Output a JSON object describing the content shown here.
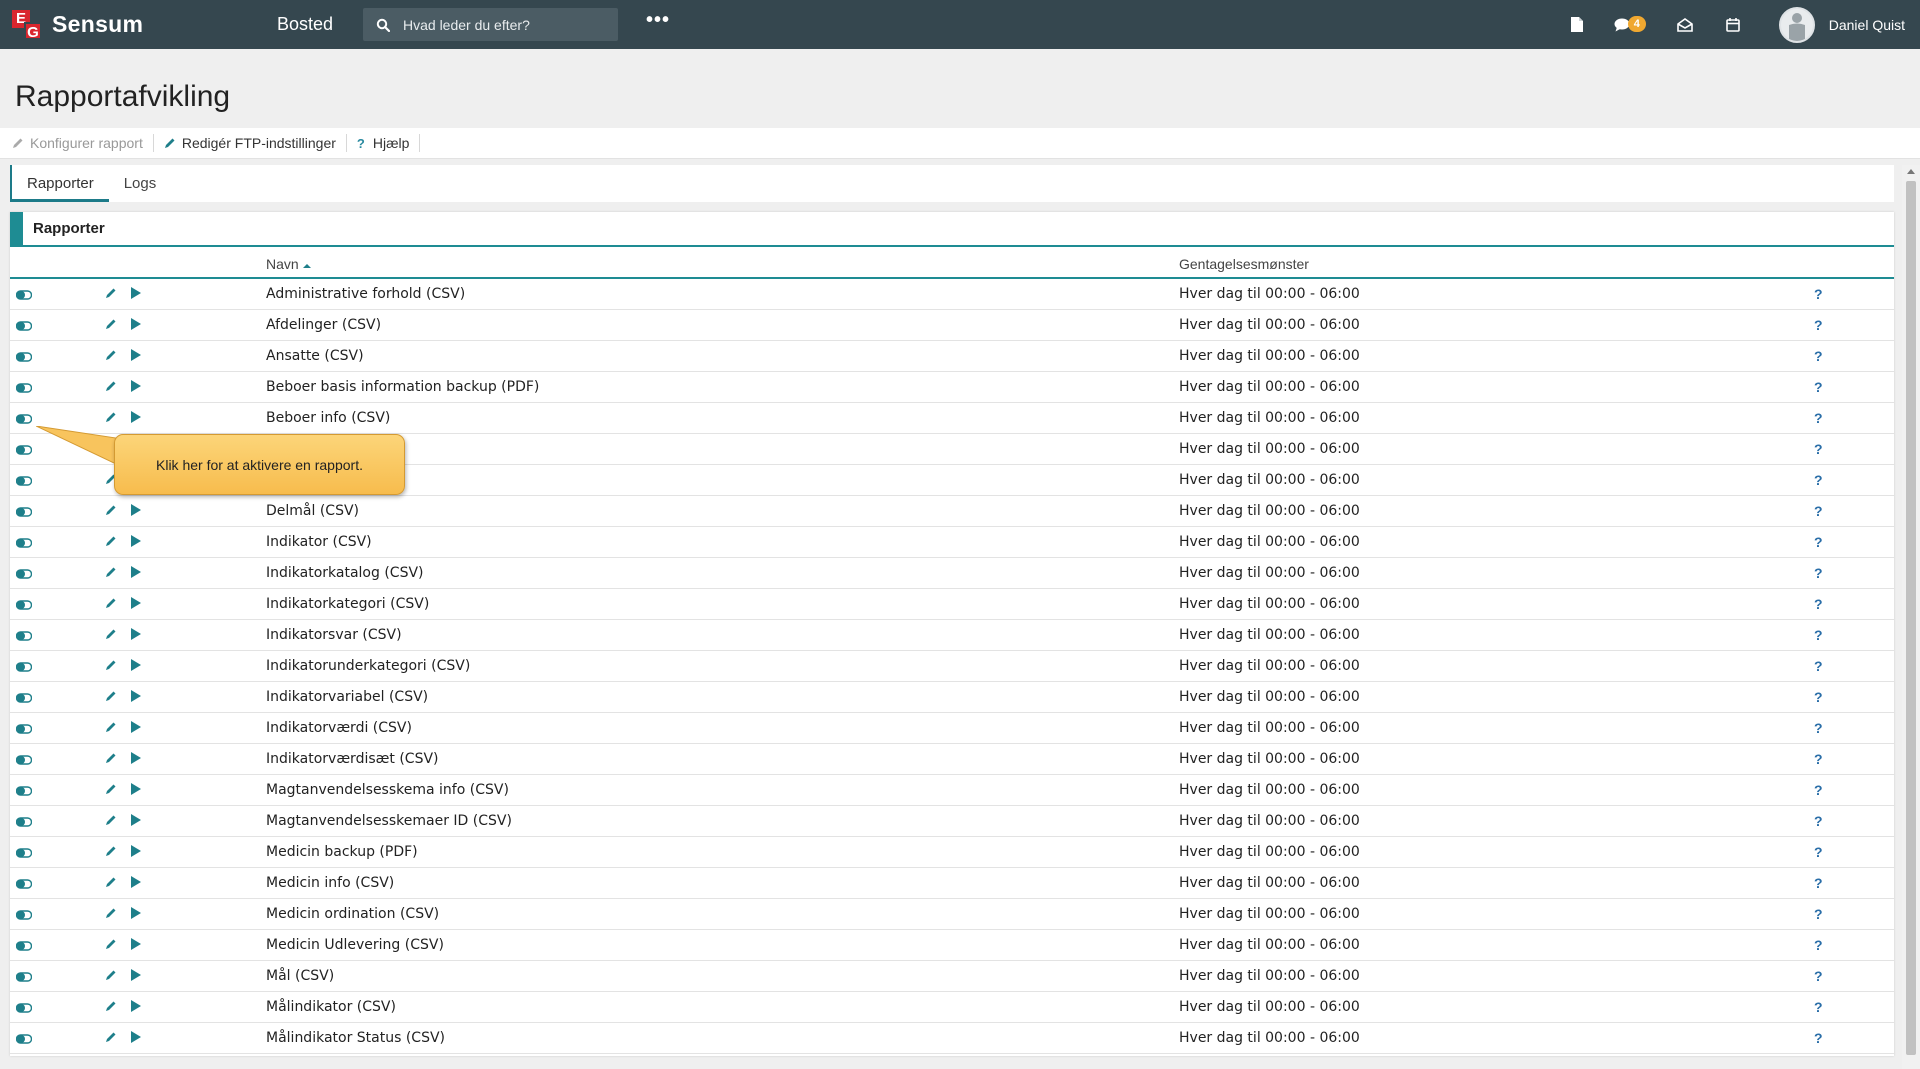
{
  "app": {
    "logo_e": "E",
    "logo_g": "G",
    "logo_text": "Sensum",
    "module": "Bosted",
    "search_placeholder": "Hvad leder du efter?",
    "more": "•••",
    "message_count": "4",
    "user_name": "Daniel Quist"
  },
  "page": {
    "title": "Rapportafvikling",
    "actions": {
      "configure": "Konfigurer rapport",
      "ftp": "Redigér FTP-indstillinger",
      "help_mark": "?",
      "help": "Hjælp"
    },
    "tabs": [
      "Rapporter",
      "Logs"
    ]
  },
  "panel": {
    "title": "Rapporter",
    "columns": {
      "name": "Navn",
      "pattern": "Gentagelsesmønster"
    },
    "rows": [
      {
        "name": "Administrative forhold (CSV)",
        "pattern": "Hver dag til 00:00 - 06:00",
        "help": "?"
      },
      {
        "name": "Afdelinger (CSV)",
        "pattern": "Hver dag til 00:00 - 06:00",
        "help": "?"
      },
      {
        "name": "Ansatte (CSV)",
        "pattern": "Hver dag til 00:00 - 06:00",
        "help": "?"
      },
      {
        "name": "Beboer basis information backup (PDF)",
        "pattern": "Hver dag til 00:00 - 06:00",
        "help": "?"
      },
      {
        "name": "Beboer info (CSV)",
        "pattern": "Hver dag til 00:00 - 06:00",
        "help": "?"
      },
      {
        "name": "",
        "pattern": "Hver dag til 00:00 - 06:00",
        "help": "?"
      },
      {
        "name": "",
        "pattern": "Hver dag til 00:00 - 06:00",
        "help": "?"
      },
      {
        "name": "Delmål (CSV)",
        "pattern": "Hver dag til 00:00 - 06:00",
        "help": "?"
      },
      {
        "name": "Indikator (CSV)",
        "pattern": "Hver dag til 00:00 - 06:00",
        "help": "?"
      },
      {
        "name": "Indikatorkatalog (CSV)",
        "pattern": "Hver dag til 00:00 - 06:00",
        "help": "?"
      },
      {
        "name": "Indikatorkategori (CSV)",
        "pattern": "Hver dag til 00:00 - 06:00",
        "help": "?"
      },
      {
        "name": "Indikatorsvar (CSV)",
        "pattern": "Hver dag til 00:00 - 06:00",
        "help": "?"
      },
      {
        "name": "Indikatorunderkategori (CSV)",
        "pattern": "Hver dag til 00:00 - 06:00",
        "help": "?"
      },
      {
        "name": "Indikatorvariabel (CSV)",
        "pattern": "Hver dag til 00:00 - 06:00",
        "help": "?"
      },
      {
        "name": "Indikatorværdi (CSV)",
        "pattern": "Hver dag til 00:00 - 06:00",
        "help": "?"
      },
      {
        "name": "Indikatorværdisæt (CSV)",
        "pattern": "Hver dag til 00:00 - 06:00",
        "help": "?"
      },
      {
        "name": "Magtanvendelsesskema info (CSV)",
        "pattern": "Hver dag til 00:00 - 06:00",
        "help": "?"
      },
      {
        "name": "Magtanvendelsesskemaer ID (CSV)",
        "pattern": "Hver dag til 00:00 - 06:00",
        "help": "?"
      },
      {
        "name": "Medicin backup (PDF)",
        "pattern": "Hver dag til 00:00 - 06:00",
        "help": "?"
      },
      {
        "name": "Medicin info (CSV)",
        "pattern": "Hver dag til 00:00 - 06:00",
        "help": "?"
      },
      {
        "name": "Medicin ordination (CSV)",
        "pattern": "Hver dag til 00:00 - 06:00",
        "help": "?"
      },
      {
        "name": "Medicin Udlevering (CSV)",
        "pattern": "Hver dag til 00:00 - 06:00",
        "help": "?"
      },
      {
        "name": "Mål (CSV)",
        "pattern": "Hver dag til 00:00 - 06:00",
        "help": "?"
      },
      {
        "name": "Målindikator (CSV)",
        "pattern": "Hver dag til 00:00 - 06:00",
        "help": "?"
      },
      {
        "name": "Målindikator Status (CSV)",
        "pattern": "Hver dag til 00:00 - 06:00",
        "help": "?"
      }
    ]
  },
  "callout": {
    "text": "Klik her for at aktivere en rapport."
  },
  "icons": {
    "toggle": "toggle-icon",
    "edit": "pencil-icon",
    "run": "play-icon",
    "accent": "#1e8c93",
    "header_bg": "#35474f",
    "badge": "#f0a830"
  }
}
